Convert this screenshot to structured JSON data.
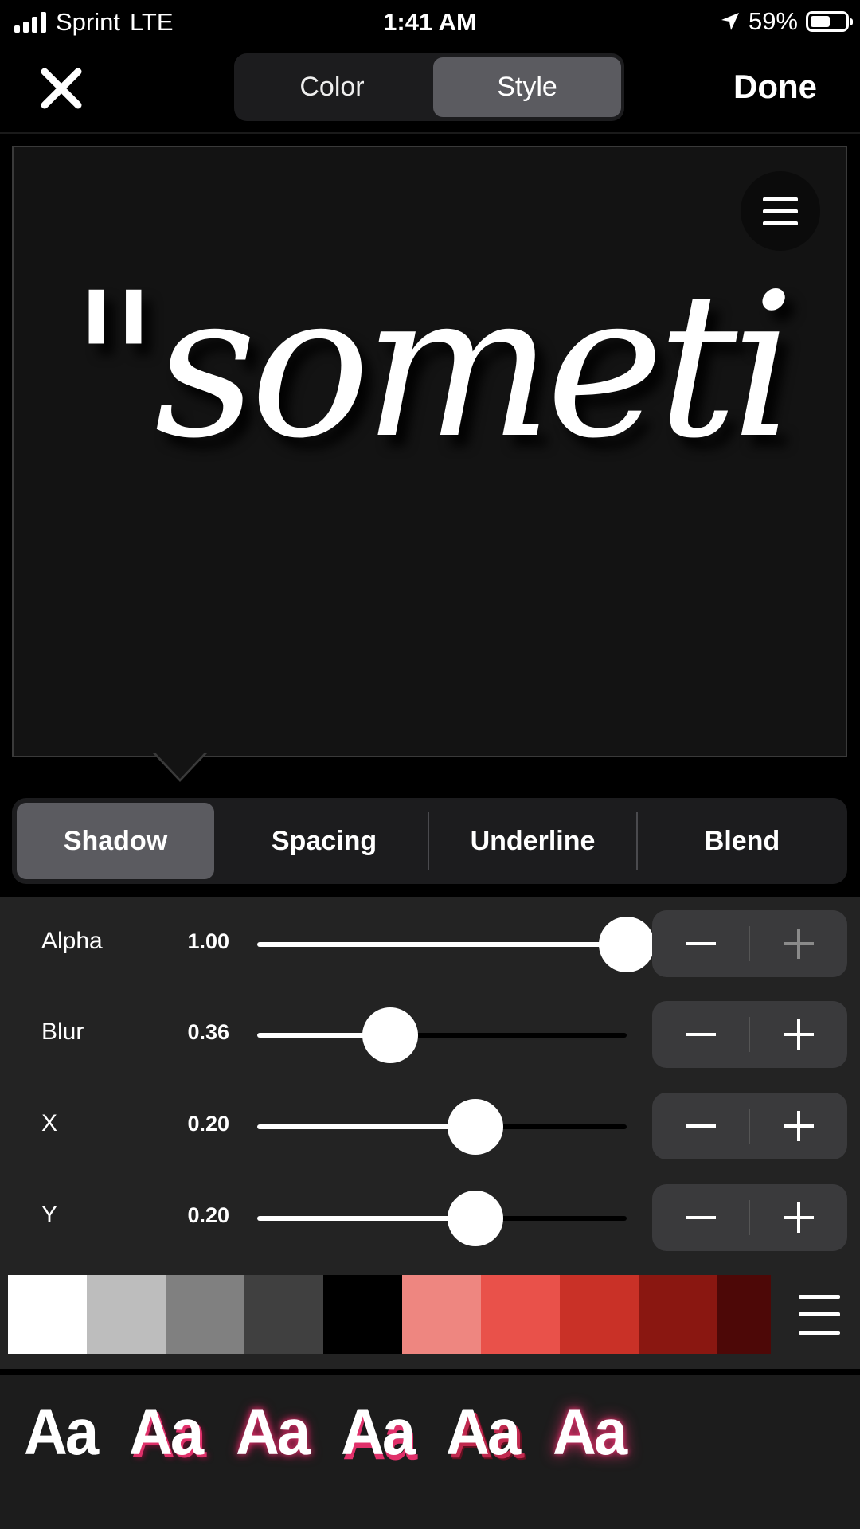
{
  "status_bar": {
    "carrier": "Sprint",
    "network": "LTE",
    "time": "1:41 AM",
    "battery": "59%",
    "battery_level": 0.59
  },
  "nav": {
    "segments": [
      {
        "label": "Color",
        "selected": false
      },
      {
        "label": "Style",
        "selected": true
      }
    ],
    "done_label": "Done"
  },
  "canvas": {
    "preview_text": "\"someti"
  },
  "tabs": [
    {
      "label": "Shadow",
      "active": true
    },
    {
      "label": "Spacing",
      "active": false
    },
    {
      "label": "Underline",
      "active": false
    },
    {
      "label": "Blend",
      "active": false
    }
  ],
  "shadow_controls": [
    {
      "label": "Alpha",
      "value": "1.00",
      "level": 1.0
    },
    {
      "label": "Blur",
      "value": "0.36",
      "level": 0.36
    },
    {
      "label": "X",
      "value": "0.20",
      "level": 0.59
    },
    {
      "label": "Y",
      "value": "0.20",
      "level": 0.59
    }
  ],
  "palette": {
    "colors": [
      "#ffffff",
      "#bdbdbd",
      "#808080",
      "#404040",
      "#000000",
      "#ee8680",
      "#e9514a",
      "#c93127",
      "#8a1711",
      "#4d0807"
    ]
  },
  "presets": [
    "Aa",
    "Aa",
    "Aa",
    "Aa",
    "Aa",
    "Aa"
  ],
  "colors": {
    "accent_shadow": "#e0306a"
  }
}
